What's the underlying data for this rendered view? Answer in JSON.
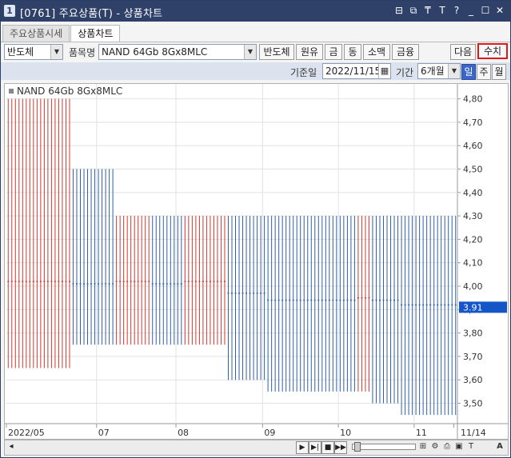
{
  "window": {
    "number_badge": "1",
    "title": "[0761] 주요상품(T) - 상품차트",
    "icons": [
      "layout-icon",
      "restore-icon",
      "pin-icon",
      "font-icon",
      "help-icon",
      "minimize-icon",
      "maximize-icon",
      "close-icon"
    ],
    "icon_glyphs": [
      "⊟",
      "⧉",
      "₸",
      "T",
      "?",
      "_",
      "☐",
      "✕"
    ]
  },
  "tabs": [
    {
      "label": "주요상품시세",
      "active": false
    },
    {
      "label": "상품차트",
      "active": true
    }
  ],
  "toolbar": {
    "category_select": "반도체",
    "item_label": "품목명",
    "item_select": "NAND 64Gb 8Gx8MLC",
    "category_buttons": [
      "반도체",
      "원유",
      "금",
      "동",
      "소맥",
      "금융"
    ],
    "next_label": "다음",
    "values_label": "수치"
  },
  "period_bar": {
    "date_label": "기준일",
    "date_value": "2022/11/15",
    "period_label": "기간",
    "period_value": "6개월",
    "interval_buttons": [
      {
        "label": "일",
        "selected": true
      },
      {
        "label": "주",
        "selected": false
      },
      {
        "label": "월",
        "selected": false
      }
    ]
  },
  "chart": {
    "legend": "NAND 64Gb 8Gx8MLC",
    "current_value_label": "3.91",
    "colors": {
      "up": "#d2372f",
      "down": "#2f5fa8",
      "tag_bg": "#1456c8"
    }
  },
  "chart_data": {
    "type": "bar",
    "series_name": "NAND 64Gb 8Gx8MLC",
    "y_ticks": [
      "4,80",
      "4,70",
      "4,60",
      "4,50",
      "4,40",
      "4,30",
      "4,20",
      "4,10",
      "4,00",
      "3,90",
      "3,80",
      "3,70",
      "3,60",
      "3,50"
    ],
    "y_tick_values": [
      4.8,
      4.7,
      4.6,
      4.5,
      4.4,
      4.3,
      4.2,
      4.1,
      4.0,
      3.9,
      3.8,
      3.7,
      3.6,
      3.5
    ],
    "ylim": [
      3.43,
      4.85
    ],
    "x_labels": [
      "2022/05",
      "07",
      "08",
      "09",
      "10",
      "11",
      "11/14"
    ],
    "x_label_index": [
      0,
      25,
      47,
      71,
      92,
      113,
      124
    ],
    "n_bars": 125,
    "segments": [
      {
        "from": 0,
        "to": 17,
        "high": 4.8,
        "low": 3.65,
        "close": 4.02,
        "color": "up"
      },
      {
        "from": 18,
        "to": 29,
        "high": 4.5,
        "low": 3.75,
        "close": 4.01,
        "color": "down"
      },
      {
        "from": 30,
        "to": 39,
        "high": 4.3,
        "low": 3.75,
        "close": 4.02,
        "color": "up"
      },
      {
        "from": 40,
        "to": 48,
        "high": 4.3,
        "low": 3.75,
        "close": 4.01,
        "color": "down"
      },
      {
        "from": 49,
        "to": 60,
        "high": 4.3,
        "low": 3.75,
        "close": 4.02,
        "color": "up"
      },
      {
        "from": 61,
        "to": 71,
        "high": 4.3,
        "low": 3.6,
        "close": 3.97,
        "color": "down"
      },
      {
        "from": 72,
        "to": 96,
        "high": 4.3,
        "low": 3.55,
        "close": 3.94,
        "color": "down"
      },
      {
        "from": 97,
        "to": 100,
        "high": 4.3,
        "low": 3.55,
        "close": 3.95,
        "color": "up"
      },
      {
        "from": 101,
        "to": 108,
        "high": 4.3,
        "low": 3.5,
        "close": 3.94,
        "color": "down"
      },
      {
        "from": 109,
        "to": 124,
        "high": 4.3,
        "low": 3.45,
        "close": 3.92,
        "color": "down"
      }
    ],
    "last_value": 3.91
  }
}
